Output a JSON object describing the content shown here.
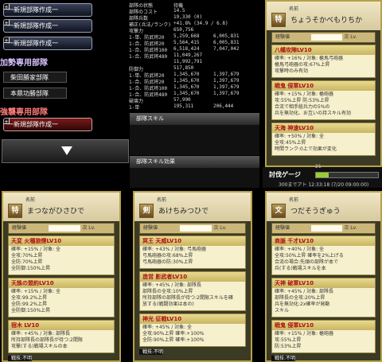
{
  "sidebar": {
    "deck_buttons": [
      "一新規部隊作成一",
      "一新規部隊作成一",
      "一新規部隊作成一",
      "一新規部隊作成一"
    ],
    "section1": "加勢専用部隊",
    "sub_tags": [
      "柴田勝家部隊",
      "本鼎功勝部隊"
    ],
    "section2": "強襲専用部隊",
    "expand_icon": "down-triangle-icon"
  },
  "stats": {
    "rows": [
      {
        "k": "部隊の状態",
        "v": "待機",
        "w": ""
      },
      {
        "k": "部隊のコスト",
        "v": "14.5",
        "w": ""
      },
      {
        "k": "部隊兵数",
        "v": "19,330 (0)",
        "w": ""
      },
      {
        "k": "補正(兵法/ランク)",
        "v": "+41.8% (34.9 / 6.8)",
        "w": ""
      },
      {
        "k": "攻撃力",
        "v": "650,756",
        "w": ""
      },
      {
        "k": "1-単、防武将20",
        "v": "5,259,668",
        "w": "6,005,831"
      },
      {
        "k": "1-合、防武将20",
        "v": "5,564,415",
        "w": "6,005,831"
      },
      {
        "k": "1-合、防武将100",
        "v": "6,518,424",
        "w": "7,047,042"
      },
      {
        "k": "1-合、防武将480",
        "v": "11,049,267",
        "w": ""
      },
      {
        "k": "",
        "v": "11,992,791",
        "w": ""
      },
      {
        "k": "防御力",
        "v": "517,850",
        "w": ""
      },
      {
        "k": "1-単、防武将20",
        "v": "1,345,670",
        "w": "1,397,679"
      },
      {
        "k": "1-合、防武将20",
        "v": "1,345,670",
        "w": "1,397,679"
      },
      {
        "k": "1-合、防武将100",
        "v": "1,345,670",
        "w": "1,397,679"
      },
      {
        "k": "1-合、防武将480",
        "v": "1,345,670",
        "w": "1,397,679"
      },
      {
        "k": "破壊力",
        "v": "57,990",
        "w": ""
      },
      {
        "k": "1-単",
        "v": "195,311",
        "w": "206,444"
      }
    ],
    "skill_bar1": "部隊スキル",
    "skill_bar2": "部隊スキル効果"
  },
  "card_right": {
    "icon": "特",
    "name_lbl": "名前",
    "name": "ちょうそかべもりちか",
    "exp_lbl": "経験値",
    "next_lbl": "次 Lv.",
    "skills": [
      {
        "title": "八幡攻陣LV10",
        "body": [
          "確率: +16% / 対象: 槍馬弓砲器",
          "槍馬弓砲器の攻:67%上昇",
          "攻撃時のみ有効"
        ]
      },
      {
        "title": "戦鬼 侵軍LV10",
        "body": [
          "確率: +15% / 対象: 槍砲器",
          "攻:55%上昇 防:53%上昇",
          "合流で相手総兵力の5%の",
          "兵を無効化、お互いの持スキル有効"
        ]
      },
      {
        "title": "天海 神速LV10",
        "body": [
          "確率: +50% / 対象: 全",
          "全攻:45%上昇",
          "時間ランク:0上で効果が変化"
        ]
      }
    ]
  },
  "gauge": {
    "label": "討伐ゲージ",
    "num": "21",
    "fill": 0.2,
    "time": "300までアト 12:33:18 (7/20 09:00:00)"
  },
  "cards_bottom": [
    {
      "icon": "特",
      "name_lbl": "名前",
      "name": "まつながひさひで",
      "exp_lbl": "経験値",
      "next_lbl": "次 Lv.",
      "skills": [
        {
          "title": "天変 火種狼煙LV10",
          "body": [
            "確率: +15% / 対象: 全",
            "全攻:70%上昇",
            "全防:70%上昇",
            "全防御:150%上昇"
          ]
        },
        {
          "title": "天誅の盟約LV10",
          "body": [
            "確率: +15% / 対象: 全",
            "全攻:99.2%上昇",
            "全防:99.2%上昇",
            "全防御:150%上昇"
          ]
        },
        {
          "title": "宿木 LV10",
          "body": [
            "確率: +45% / 対象: 部隊長",
            "所持部隊長の部隊長が待つ:2間限",
            "攻撃(する)戦場スキルの本"
          ]
        }
      ],
      "foot": "戦技:不明"
    },
    {
      "icon": "剣",
      "name_lbl": "名前",
      "name": "あけちみつひで",
      "exp_lbl": "経験値",
      "next_lbl": "次 Lv.",
      "skills": [
        {
          "title": "冥王 天威LV10",
          "body": [
            "確率: +43% / 対象: 弓馬砲器",
            "弓馬砲器の攻:68%上昇",
            "弓馬砲器の防:30%上昇"
          ]
        },
        {
          "title": "造営 影武者LV10",
          "body": [
            "確率: +45% / 対象: 部隊長",
            "部隊長の全攻:10%上昇",
            "所持部隊の部隊長が待つ:2間限スキルを確",
            "放する(戦闘効果は本の)"
          ]
        },
        {
          "title": "神光 征戦LV10",
          "body": [
            "確率: +45% / 対象: 全",
            "全攻:90%上昇 確率:+100%",
            "全防:90%上昇 確率:+100%"
          ]
        }
      ],
      "foot": "戦技:不明"
    },
    {
      "icon": "文",
      "name_lbl": "名前",
      "name": "つだそうぎゅう",
      "exp_lbl": "経験値",
      "next_lbl": "次 Lv.",
      "skills": [
        {
          "title": "商脈 千才LV10",
          "body": [
            "確率: +40% / 対象: 全",
            "全攻:50%上昇 確率を2%上げる",
            "合流の場合:先頭の部隊が本で",
            "兵(する)戦場スキルを本"
          ]
        },
        {
          "title": "天神 破軍LV10",
          "body": [
            "確率: +45% / 対象: 部隊長",
            "部隊長の全攻:20%上昇",
            "兵を無効化:2x確率が発動",
            "スキル"
          ]
        },
        {
          "title": "戦鬼 侵軍LV10",
          "body": [
            "確率: +15% / 対象: 槍砲器",
            "攻:55%上昇",
            "防:53%上昇"
          ]
        }
      ],
      "foot": "戦技:不明"
    }
  ]
}
